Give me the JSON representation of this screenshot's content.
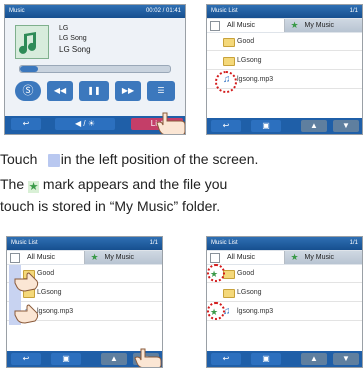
{
  "player": {
    "title": "Music",
    "time": "00:02 / 01:41",
    "artist": "LG",
    "album": "LG Song",
    "song": "LG Song",
    "list_button": "List"
  },
  "list_screens": {
    "title": "Music List",
    "page": "1/1",
    "tab_all": "All Music",
    "tab_my": "My Music",
    "items": [
      "Good",
      "LGsong",
      "lgsong.mp3"
    ]
  },
  "captions": {
    "line1": "Touch      in the left position of the screen.",
    "line2_a": "The",
    "line2_b": "mark appears and the file you",
    "line3": "touch is stored in “My Music” folder."
  },
  "icons": [
    "folder-icon",
    "music-note-icon",
    "star-icon",
    "checkbox-icon",
    "hand-pointer-icon",
    "back-icon",
    "play-pause-icon",
    "rewind-icon",
    "fast-forward-icon",
    "menu-icon"
  ],
  "colors": {
    "accent": "#1f5fa8",
    "marker": "#d31b1b",
    "screen_bg": "#f4f4f4"
  }
}
